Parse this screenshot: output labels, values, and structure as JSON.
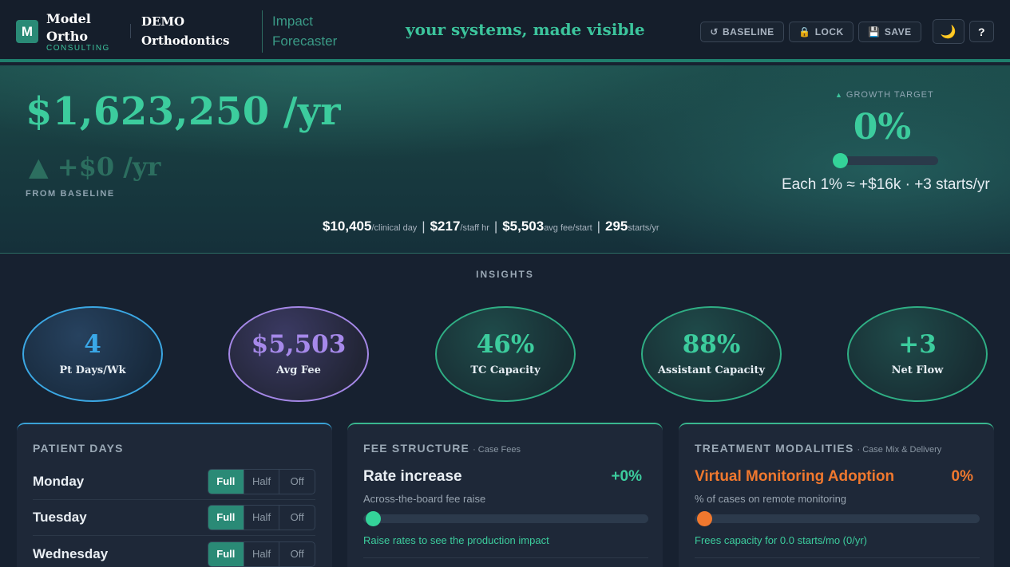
{
  "header": {
    "logo_letter": "M",
    "brand_name": "Model Ortho",
    "brand_sub": "CONSULTING",
    "practice_name": "DEMO Orthodontics",
    "tool_name": "Impact Forecaster",
    "tagline": "your systems, made visible",
    "buttons": {
      "baseline": "BASELINE",
      "lock": "LOCK",
      "save": "SAVE",
      "theme_icon": "🌙",
      "help": "?"
    }
  },
  "hero": {
    "annual_production": "$1,623,250 /yr",
    "delta": "▲ +$0 /yr",
    "from_baseline": "FROM BASELINE",
    "growth_target_label": "GROWTH TARGET",
    "growth_target_value": "0%",
    "growth_target_fraction": 0,
    "growth_note": "Each 1% ≈ +$16k · +3 starts/yr",
    "metrics": [
      {
        "value": "$10,405",
        "unit": "/clinical day"
      },
      {
        "value": "$217",
        "unit": "/staff hr"
      },
      {
        "value": "$5,503",
        "unit": "avg fee/start"
      },
      {
        "value": "295",
        "unit": "starts/yr"
      }
    ]
  },
  "insights": {
    "title": "INSIGHTS",
    "bubbles": [
      {
        "value": "4",
        "label": "Pt Days/Wk"
      },
      {
        "value": "$5,503",
        "label": "Avg Fee"
      },
      {
        "value": "46%",
        "label": "TC Capacity"
      },
      {
        "value": "88%",
        "label": "Assistant Capacity"
      },
      {
        "value": "+3",
        "label": "Net Flow"
      }
    ]
  },
  "patient_days": {
    "title": "PATIENT DAYS",
    "options": [
      "Full",
      "Half",
      "Off"
    ],
    "days": [
      {
        "name": "Monday",
        "selected": "Full"
      },
      {
        "name": "Tuesday",
        "selected": "Full"
      },
      {
        "name": "Wednesday",
        "selected": "Full"
      }
    ]
  },
  "fee_structure": {
    "title": "FEE STRUCTURE",
    "subtitle": "· Case Fees",
    "label": "Rate increase",
    "value": "+0%",
    "fraction": 0,
    "help": "Across-the-board fee raise",
    "note": "Raise rates to see the production impact"
  },
  "treatment_modalities": {
    "title": "TREATMENT MODALITIES",
    "subtitle": "· Case Mix & Delivery",
    "label": "Virtual Monitoring Adoption",
    "value": "0%",
    "fraction": 0,
    "help": "% of cases on remote monitoring",
    "note": "Frees capacity for 0.0 starts/mo (0/yr)"
  },
  "colors": {
    "accent": "#3ccc9d",
    "brand": "#2a8a76",
    "blue": "#3aa8e8",
    "purple": "#a689ea",
    "orange": "#f0782e"
  }
}
